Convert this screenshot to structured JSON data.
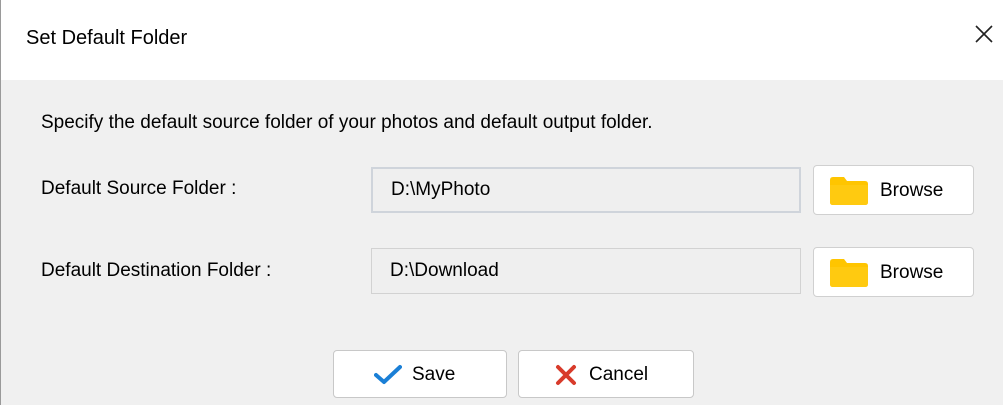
{
  "window": {
    "title": "Set Default Folder"
  },
  "description": "Specify the default source folder of your photos and default output folder.",
  "source": {
    "label": "Default Source Folder :",
    "value": "D:\\MyPhoto",
    "browse_label": "Browse"
  },
  "destination": {
    "label": "Default Destination Folder :",
    "value": "D:\\Download",
    "browse_label": "Browse"
  },
  "actions": {
    "save_label": "Save",
    "cancel_label": "Cancel"
  },
  "icons": {
    "close": "close-icon",
    "folder": "folder-icon",
    "save": "checkmark-icon",
    "cancel": "x-icon"
  },
  "colors": {
    "folder": "#FFC500",
    "checkmark": "#1A7FD6",
    "cancel_x": "#D83B2B"
  }
}
